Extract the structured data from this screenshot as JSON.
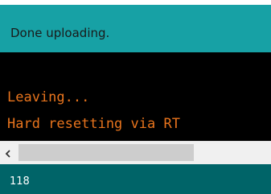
{
  "status": {
    "message": "Done uploading."
  },
  "console": {
    "lines": [
      "Leaving...",
      "Hard resetting via RT"
    ],
    "text_color": "#e8741d",
    "background": "#000000"
  },
  "scrollbar": {
    "left_arrow_icon": "chevron-left-icon",
    "thumb_position": 0.0
  },
  "footer": {
    "line_number": "118"
  },
  "colors": {
    "status_bar": "#17a1a5",
    "footer": "#006468"
  }
}
